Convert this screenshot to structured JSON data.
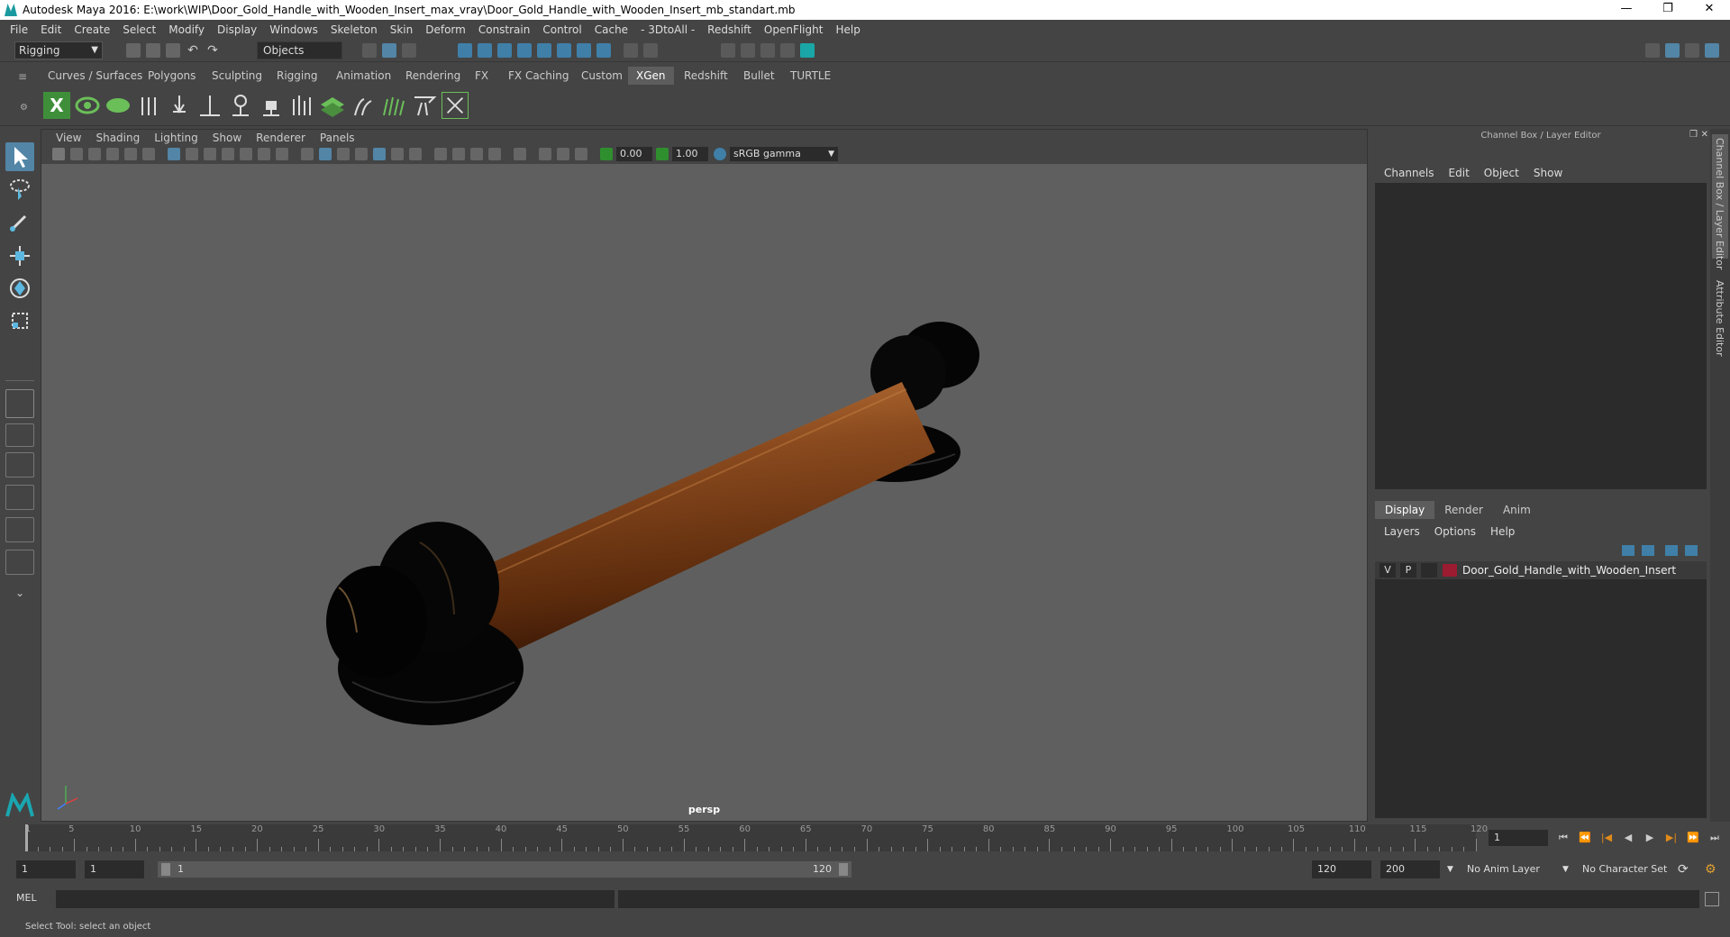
{
  "window": {
    "title": "Autodesk Maya 2016: E:\\work\\WIP\\Door_Gold_Handle_with_Wooden_Insert_max_vray\\Door_Gold_Handle_with_Wooden_Insert_mb_standart.mb",
    "minimize": "—",
    "restore": "❐",
    "close": "✕"
  },
  "menu": [
    "File",
    "Edit",
    "Create",
    "Select",
    "Modify",
    "Display",
    "Windows",
    "Skeleton",
    "Skin",
    "Deform",
    "Constrain",
    "Control",
    "Cache",
    "- 3DtoAll -",
    "Redshift",
    "OpenFlight",
    "Help"
  ],
  "status_line": {
    "workspace": "Rigging",
    "selection_mode": "Objects"
  },
  "shelf": {
    "tabs": [
      "Curves / Surfaces",
      "Polygons",
      "Sculpting",
      "Rigging",
      "Animation",
      "Rendering",
      "FX",
      "FX Caching",
      "Custom",
      "XGen",
      "Redshift",
      "Bullet",
      "TURTLE"
    ],
    "active_tab": "XGen"
  },
  "panel": {
    "menu": [
      "View",
      "Shading",
      "Lighting",
      "Show",
      "Renderer",
      "Panels"
    ],
    "exposure": "0.00",
    "gamma": "1.00",
    "color_space": "sRGB gamma",
    "camera_label": "persp"
  },
  "channel_box": {
    "title": "Channel Box / Layer Editor",
    "menu": [
      "Channels",
      "Edit",
      "Object",
      "Show"
    ],
    "layer_tabs": [
      "Display",
      "Render",
      "Anim"
    ],
    "active_layer_tab": "Display",
    "layer_menu": [
      "Layers",
      "Options",
      "Help"
    ],
    "layer": {
      "visible": "V",
      "playback": "P",
      "name": "Door_Gold_Handle_with_Wooden_Insert",
      "color": "#9b1b30"
    }
  },
  "side_tabs": [
    "Channel Box / Layer Editor",
    "Attribute Editor"
  ],
  "timeline": {
    "start": "1",
    "current_frame": "1",
    "tick_labels": [
      "5",
      "10",
      "15",
      "20",
      "25",
      "30",
      "35",
      "40",
      "45",
      "50",
      "55",
      "60",
      "65",
      "70",
      "75",
      "80",
      "85",
      "90",
      "95",
      "100",
      "105",
      "110",
      "115",
      "120"
    ]
  },
  "range": {
    "start": "1",
    "playback_start": "1",
    "slider_start": "1",
    "slider_end": "120",
    "playback_end": "120",
    "end": "200",
    "anim_layer": "No Anim Layer",
    "character_set": "No Character Set"
  },
  "command": {
    "language": "MEL"
  },
  "help_line": "Select Tool: select an object",
  "colors": {
    "accent": "#5285a6",
    "xgen_green": "#6bbf59",
    "wood": "#8a4a1e"
  }
}
